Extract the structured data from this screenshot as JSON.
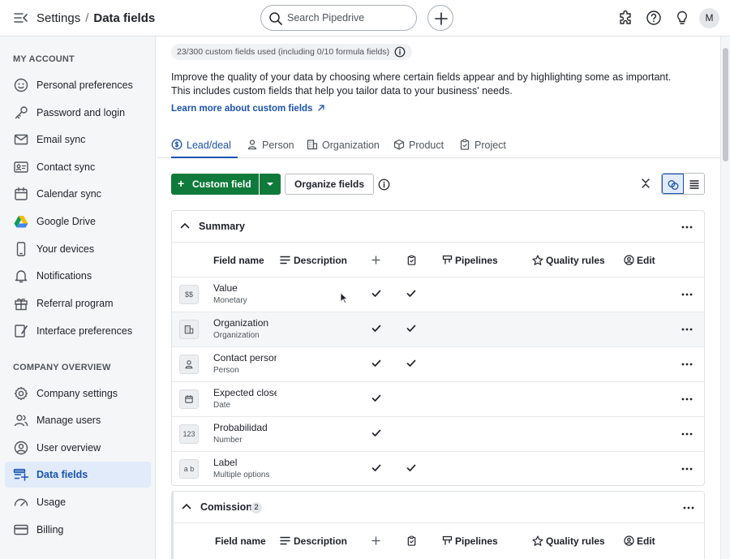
{
  "header": {
    "breadcrumb_root": "Settings",
    "breadcrumb_sep": "/",
    "breadcrumb_current": "Data fields",
    "search_placeholder": "Search Pipedrive",
    "avatar_initial": "M"
  },
  "sidebar": {
    "my_account_title": "MY ACCOUNT",
    "company_title": "COMPANY OVERVIEW",
    "my_account_items": [
      {
        "label": "Personal preferences",
        "icon": "smiley-icon"
      },
      {
        "label": "Password and login",
        "icon": "key-icon"
      },
      {
        "label": "Email sync",
        "icon": "envelope-icon"
      },
      {
        "label": "Contact sync",
        "icon": "contact-card-icon"
      },
      {
        "label": "Calendar sync",
        "icon": "calendar-icon"
      },
      {
        "label": "Google Drive",
        "icon": "google-drive-icon"
      },
      {
        "label": "Your devices",
        "icon": "phone-icon"
      },
      {
        "label": "Notifications",
        "icon": "bell-icon"
      },
      {
        "label": "Referral program",
        "icon": "gift-icon"
      },
      {
        "label": "Interface preferences",
        "icon": "brush-icon"
      }
    ],
    "company_items": [
      {
        "label": "Company settings",
        "icon": "gear-icon"
      },
      {
        "label": "Manage users",
        "icon": "users-icon"
      },
      {
        "label": "User overview",
        "icon": "user-circle-icon"
      },
      {
        "label": "Data fields",
        "icon": "data-fields-icon",
        "active": true
      },
      {
        "label": "Usage",
        "icon": "gauge-icon"
      },
      {
        "label": "Billing",
        "icon": "credit-card-icon"
      }
    ]
  },
  "main": {
    "usage_text": "23/300 custom fields used (including 0/10 formula fields)",
    "intro_text": "Improve the quality of your data by choosing where certain fields appear and by highlighting some as important. This includes custom fields that help you tailor data to your business' needs.",
    "learn_more": "Learn more about custom fields",
    "tabs": [
      {
        "label": "Lead/deal",
        "icon": "dollar-circle-icon",
        "active": true
      },
      {
        "label": "Person",
        "icon": "person-icon"
      },
      {
        "label": "Organization",
        "icon": "building-icon"
      },
      {
        "label": "Product",
        "icon": "box-icon"
      },
      {
        "label": "Project",
        "icon": "clipboard-icon"
      }
    ],
    "custom_field_button": "Custom field",
    "custom_field_plus": "+",
    "organize_button": "Organize fields",
    "columns": {
      "field_name": "Field name",
      "description": "Description",
      "pipelines": "Pipelines",
      "quality_rules": "Quality rules",
      "edit": "Edit"
    },
    "sections": [
      {
        "title": "Summary",
        "count": "",
        "rows": [
          {
            "name": "Value",
            "type": "Monetary",
            "icon_text": "$$",
            "add": true,
            "detail": true
          },
          {
            "name": "Organization",
            "type": "Organization",
            "icon_text": "",
            "icon": "building-icon",
            "add": true,
            "detail": true
          },
          {
            "name": "Contact person",
            "type": "Person",
            "icon_text": "",
            "icon": "person-icon",
            "add": true,
            "detail": true
          },
          {
            "name": "Expected close date",
            "type": "Date",
            "icon_text": "",
            "icon": "calendar-icon",
            "add": true,
            "detail": false
          },
          {
            "name": "Probabilidad",
            "type": "Number",
            "icon_text": "123",
            "add": true,
            "detail": false
          },
          {
            "name": "Label",
            "type": "Multiple options",
            "icon_text": "a b",
            "add": true,
            "detail": true
          }
        ]
      },
      {
        "title": "Comission",
        "count": "2",
        "rows": []
      }
    ]
  }
}
